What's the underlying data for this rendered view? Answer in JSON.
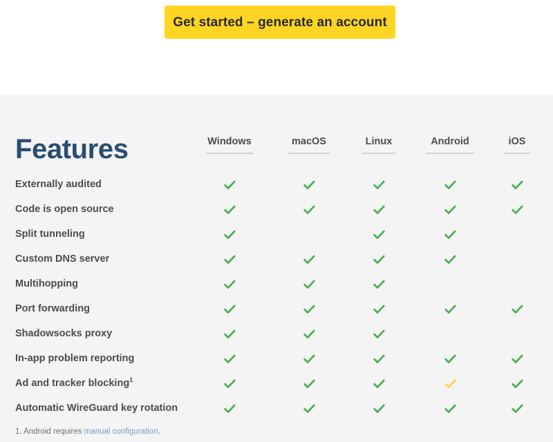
{
  "cta": {
    "button_label": "Get started – generate an account"
  },
  "features_section": {
    "title": "Features",
    "platforms": [
      "Windows",
      "macOS",
      "Linux",
      "Android",
      "iOS"
    ],
    "rows": [
      {
        "label": "Externally audited",
        "support": [
          "yes",
          "yes",
          "yes",
          "yes",
          "yes"
        ]
      },
      {
        "label": "Code is open source",
        "support": [
          "yes",
          "yes",
          "yes",
          "yes",
          "yes"
        ]
      },
      {
        "label": "Split tunneling",
        "support": [
          "yes",
          "no",
          "yes",
          "yes",
          "no"
        ]
      },
      {
        "label": "Custom DNS server",
        "support": [
          "yes",
          "yes",
          "yes",
          "yes",
          "no"
        ]
      },
      {
        "label": "Multihopping",
        "support": [
          "yes",
          "yes",
          "yes",
          "no",
          "no"
        ]
      },
      {
        "label": "Port forwarding",
        "support": [
          "yes",
          "yes",
          "yes",
          "yes",
          "yes"
        ]
      },
      {
        "label": "Shadowsocks proxy",
        "support": [
          "yes",
          "yes",
          "yes",
          "no",
          "no"
        ]
      },
      {
        "label": "In-app problem reporting",
        "support": [
          "yes",
          "yes",
          "yes",
          "yes",
          "yes"
        ]
      },
      {
        "label": "Ad and tracker blocking",
        "footnote_marker": "1",
        "support": [
          "yes",
          "yes",
          "yes",
          "partial",
          "yes"
        ]
      },
      {
        "label": "Automatic WireGuard key rotation",
        "support": [
          "yes",
          "yes",
          "yes",
          "yes",
          "yes"
        ]
      }
    ],
    "footnote": {
      "prefix": "1. Android requires ",
      "link_text": "manual configuration",
      "suffix": "."
    }
  },
  "colors": {
    "page_background": "#ffffff",
    "panel_background": "#f4f4f4",
    "cta_yellow": "#ffd524",
    "cta_text": "#28292b",
    "title_navy": "#294d73",
    "body_text": "#4c4c4c",
    "check_green": "#49ad52",
    "check_yellow": "#ffd24c",
    "rule_gray": "#d2d2d2",
    "footnote_text": "#6f6f6f",
    "link_blue": "#7c9ac2"
  },
  "layout": {
    "column_centers": [
      332,
      447,
      548,
      651,
      748
    ],
    "column_rule_widths": [
      68,
      60,
      48,
      70,
      38
    ]
  }
}
